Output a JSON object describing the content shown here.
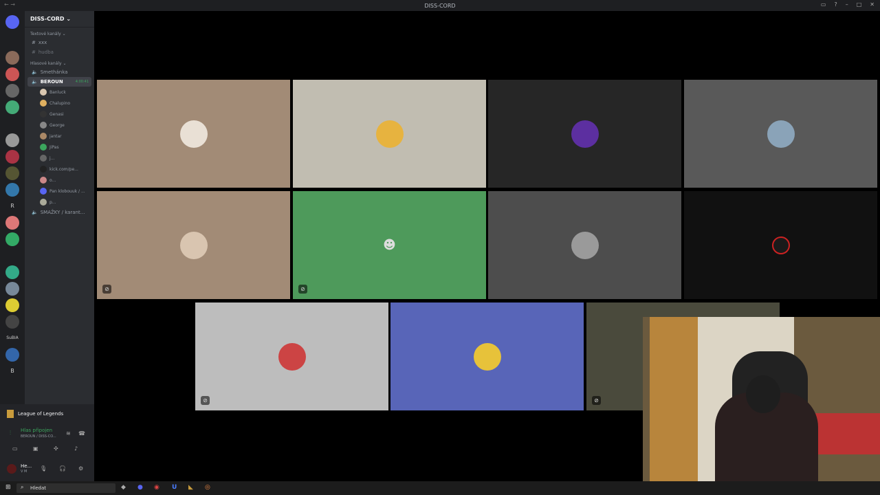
{
  "window": {
    "title": "DISS-CORD"
  },
  "server": {
    "name": "DISS-CORD ⌄"
  },
  "categories": {
    "text": "Textové kanály ⌄",
    "voice": "Hlasové kanály ⌄"
  },
  "text_channels": [
    "xxx",
    "hudba"
  ],
  "voice_channels": {
    "smethanka": "Smethánka",
    "beroun": "BEROUN",
    "beroun_time": "4:00:41",
    "smazky": "SMAŽKY / karant..."
  },
  "voice_users": [
    "Banluck",
    "Chalupino",
    "Genasi",
    "George",
    "jantar",
    "JiPas",
    "j...",
    "kick.com/pe...",
    "o...",
    "Pan klobouuk / ...",
    "p..."
  ],
  "server_labels": [
    "R",
    "SuBIA",
    "B"
  ],
  "activity": {
    "game": "League of Legends"
  },
  "connection": {
    "status": "Hlas připojen",
    "channel": "BEROUN / DISS-CO..."
  },
  "profile": {
    "name": "He...",
    "status": "V M"
  },
  "taskbar": {
    "search_placeholder": "Hledat"
  },
  "colors": {
    "accent": "#3ba55d",
    "blurple": "#5865f2"
  }
}
